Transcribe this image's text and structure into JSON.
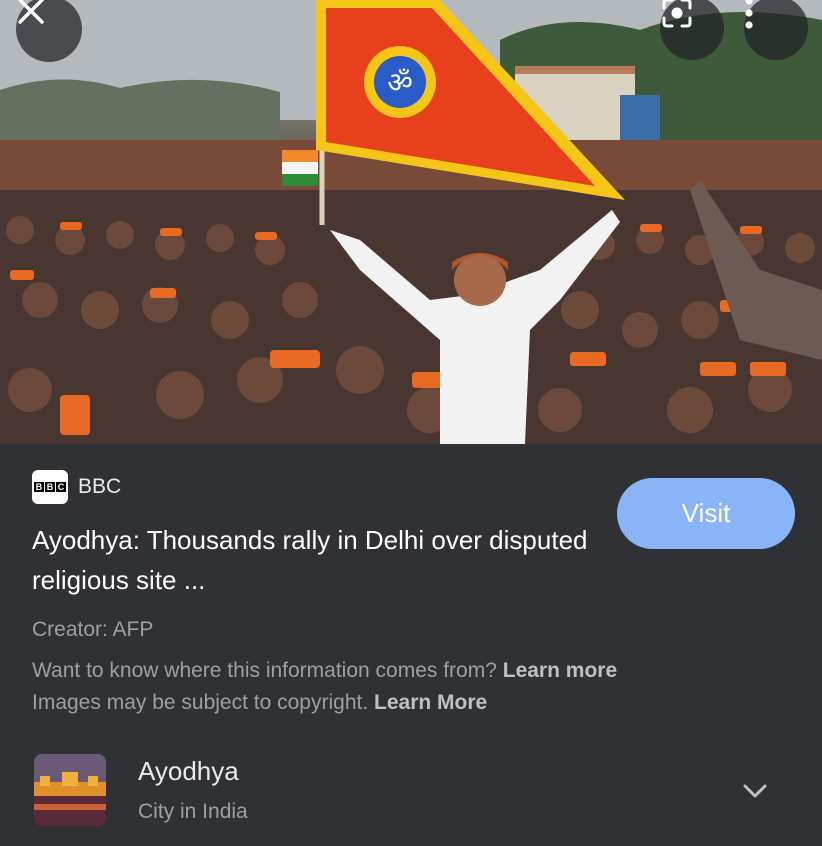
{
  "image": {
    "description_icon": "rally-photo"
  },
  "overlay": {
    "close_icon": "close-icon",
    "lens_icon": "lens-icon",
    "more_icon": "more-vert-icon"
  },
  "source": {
    "logo": "BBC",
    "name": "BBC"
  },
  "title": "Ayodhya: Thousands rally in Delhi over disputed religious site ...",
  "visit_label": "Visit",
  "creator": "Creator: AFP",
  "info": {
    "line1": "Want to know where this information comes from?",
    "line1_link": "Learn more",
    "line2": "Images may be subject to copyright.",
    "line2_link": "Learn More"
  },
  "entity": {
    "name": "Ayodhya",
    "description": "City in India"
  },
  "colors": {
    "panel_bg": "#303134",
    "visit_bg": "#8ab4f8",
    "flag_yellow": "#f5c518",
    "flag_red": "#e8401c"
  }
}
